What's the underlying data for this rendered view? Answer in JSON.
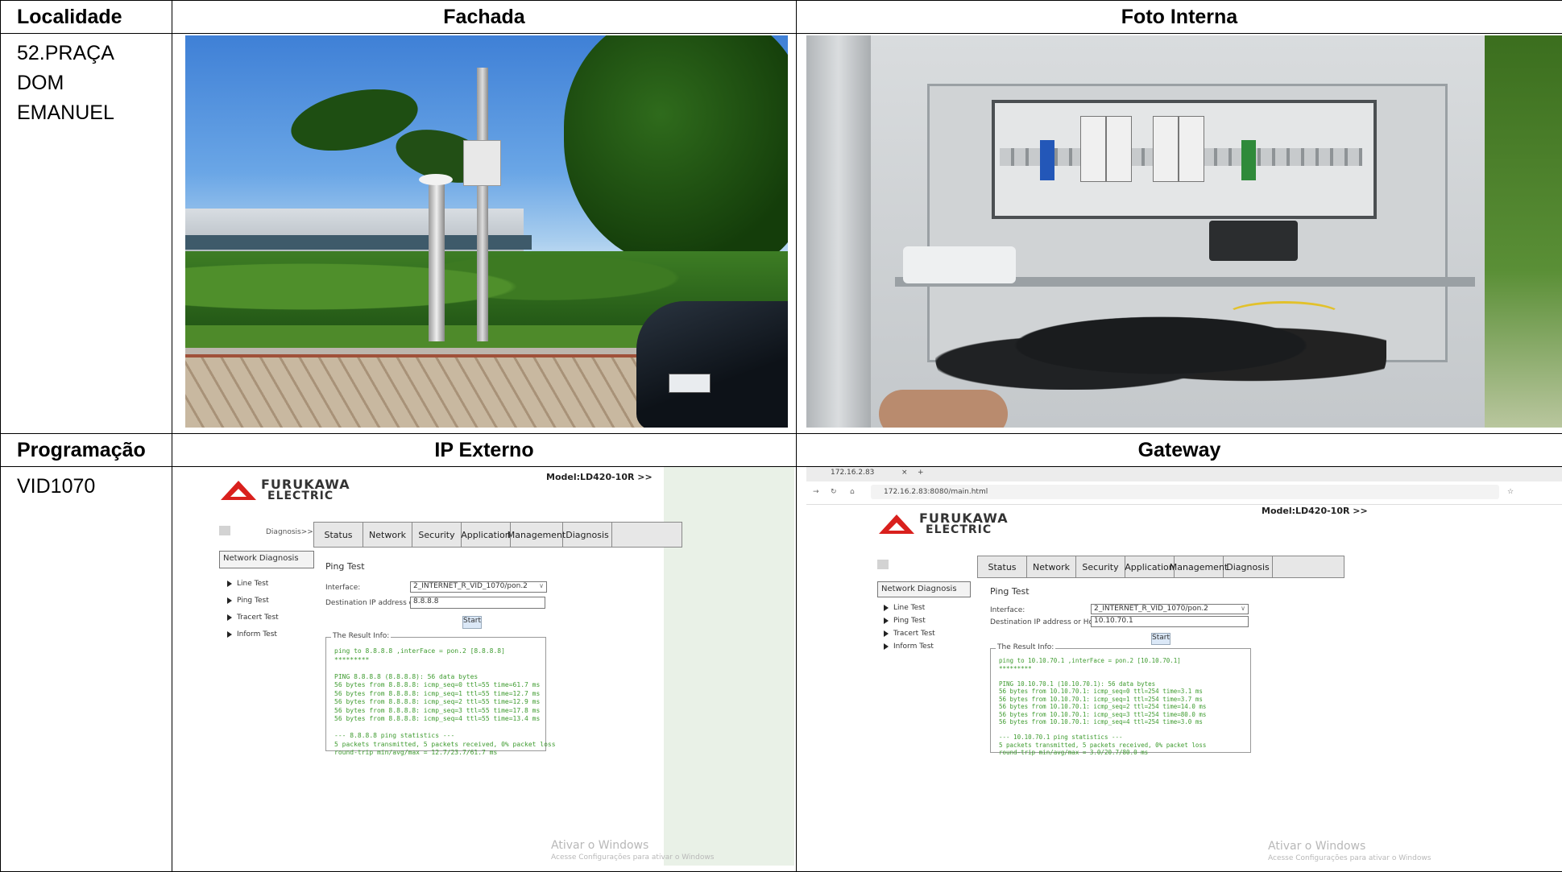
{
  "table": {
    "row1": {
      "col1": "Localidade",
      "col2": "Fachada",
      "col3": "Foto Interna"
    },
    "location": [
      "52.PRAÇA",
      "DOM",
      "EMANUEL"
    ],
    "row3": {
      "col1": "Programação",
      "col2": "IP Externo",
      "col3": "Gateway"
    },
    "program": "VID1070"
  },
  "router_ui": {
    "brand_line1": "FURUKAWA",
    "brand_line2": "ELECTRIC",
    "model": "Model:LD420-10R >>",
    "breadcrumb": "Diagnosis>>Netw",
    "tabs": [
      "Status",
      "Network",
      "Security",
      "Application",
      "Management",
      "Diagnosis"
    ],
    "side_header": "Network Diagnosis",
    "side_items": [
      "Line Test",
      "Ping Test",
      "Tracert Test",
      "Inform Test"
    ],
    "page_title": "Ping Test",
    "interface_label": "Interface:",
    "interface_value": "2_INTERNET_R_VID_1070/pon.2",
    "dest_label": "Destination IP address or Host Name:",
    "start": "Start",
    "result_legend": "The Result Info:",
    "watermark1": "Ativar o Windows",
    "watermark2": "Acesse Configurações para ativar o Windows"
  },
  "external": {
    "dest_value": "8.8.8.8",
    "result": "ping to 8.8.8.8 ,interFace = pon.2 [8.8.8.8]\n*********\n\nPING 8.8.8.8 (8.8.8.8): 56 data bytes\n56 bytes from 8.8.8.8: icmp_seq=0 ttl=55 time=61.7 ms\n56 bytes from 8.8.8.8: icmp_seq=1 ttl=55 time=12.7 ms\n56 bytes from 8.8.8.8: icmp_seq=2 ttl=55 time=12.9 ms\n56 bytes from 8.8.8.8: icmp_seq=3 ttl=55 time=17.8 ms\n56 bytes from 8.8.8.8: icmp_seq=4 ttl=55 time=13.4 ms\n\n--- 8.8.8.8 ping statistics ---\n5 packets transmitted, 5 packets received, 0% packet loss\nround-trip min/avg/max = 12.7/23.7/61.7 ms"
  },
  "gateway": {
    "tab_title": "172.16.2.83",
    "url": "172.16.2.83:8080/main.html",
    "dest_value": "10.10.70.1",
    "result": "ping to 10.10.70.1 ,interFace = pon.2 [10.10.70.1]\n*********\n\nPING 10.10.70.1 (10.10.70.1): 56 data bytes\n56 bytes from 10.10.70.1: icmp_seq=0 ttl=254 time=3.1 ms\n56 bytes from 10.10.70.1: icmp_seq=1 ttl=254 time=3.7 ms\n56 bytes from 10.10.70.1: icmp_seq=2 ttl=254 time=14.0 ms\n56 bytes from 10.10.70.1: icmp_seq=3 ttl=254 time=80.0 ms\n56 bytes from 10.10.70.1: icmp_seq=4 ttl=254 time=3.0 ms\n\n--- 10.10.70.1 ping statistics ---\n5 packets transmitted, 5 packets received, 0% packet loss\nround-trip min/avg/max = 3.0/20.7/80.0 ms"
  }
}
